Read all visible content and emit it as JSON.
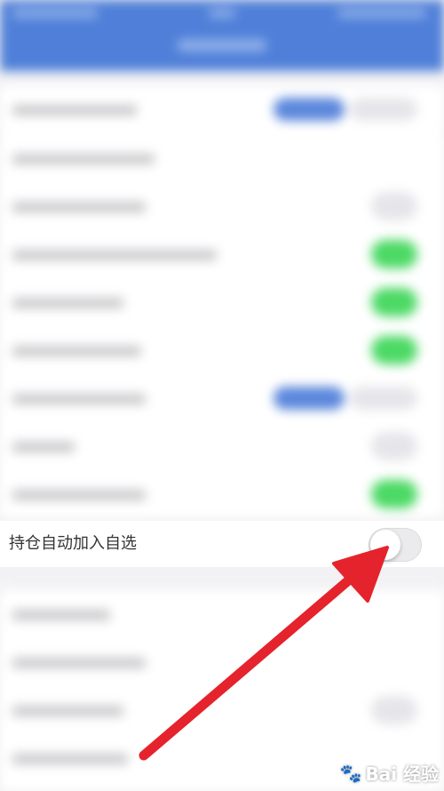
{
  "settings": {
    "focused_row": {
      "label": "持仓自动加入自选",
      "toggle_state": "off"
    }
  },
  "colors": {
    "header_blue": "#4f7fd8",
    "switch_on": "#4cd964",
    "annotation_arrow": "#e5232c"
  },
  "watermark": {
    "text": "Bai 经验"
  }
}
